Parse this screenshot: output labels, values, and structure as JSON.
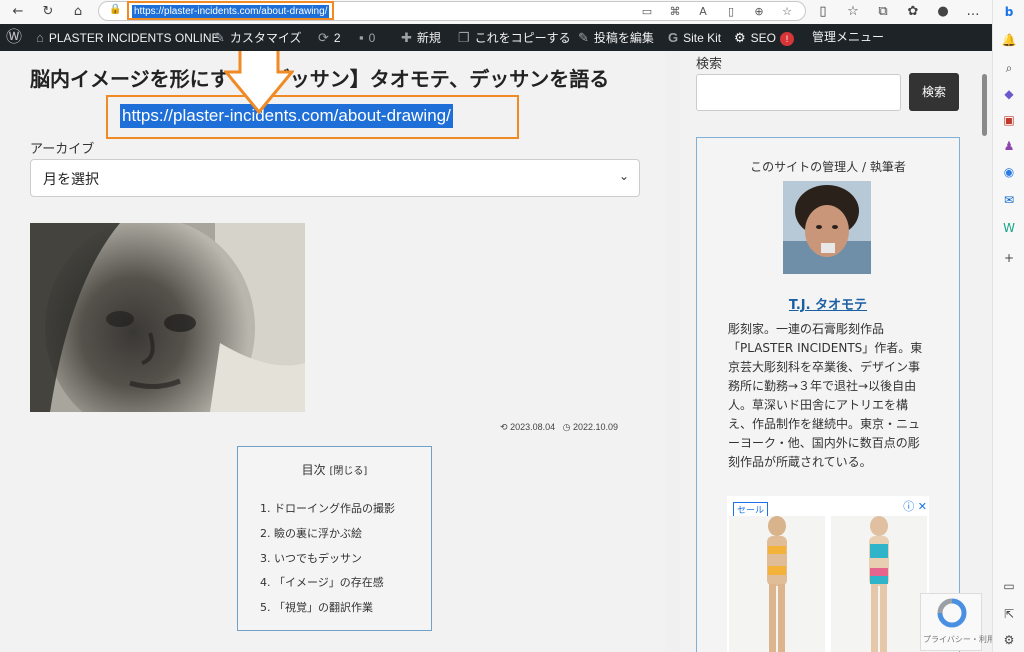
{
  "browser": {
    "url": "https://plaster-incidents.com/about-drawing/",
    "nav_icons": [
      "back-arrow-icon",
      "refresh-icon",
      "home-icon"
    ],
    "right_icons": [
      "app-available-icon",
      "apps-icon",
      "read-aloud-icon",
      "immersive-reader-icon",
      "zoom-icon",
      "favorite-star-icon",
      "split-screen-icon",
      "favorites-icon",
      "collections-icon",
      "extensions-icon",
      "profile-icon",
      "more-icon"
    ],
    "sidebar_icons": [
      "bing-chat-icon",
      "bell-icon",
      "search-icon",
      "tag-icon",
      "briefcase-icon",
      "games-icon",
      "office-icon",
      "outlook-icon",
      "shopping-icon",
      "add-icon",
      "hide-sidebar-icon",
      "open-external-icon",
      "settings-icon"
    ]
  },
  "adminbar": {
    "site_name": "PLASTER INCIDENTS ONLINE",
    "customize": "カスタマイズ",
    "updates_count": "2",
    "comments_count": "0",
    "new": "新規",
    "copy": "これをコピーする",
    "edit_post": "投稿を編集",
    "site_kit": "Site Kit",
    "seo": "SEO",
    "seo_badge": "!",
    "admin_menu": "管理メニュー"
  },
  "post": {
    "title": "脳内イメージを形にする【デッサン】タオモテ、デッサンを語る",
    "highlighted_link": "https://plaster-incidents.com/about-drawing/",
    "archive_label": "アーカイブ",
    "month_select": "月を選択",
    "updated_date": "2023.08.04",
    "published_date": "2022.10.09"
  },
  "toc": {
    "title": "目次",
    "close_label": "[閉じる]",
    "items": [
      "1. ドローイング作品の撮影",
      "2. 瞼の裏に浮かぶ絵",
      "3. いつでもデッサン",
      "4. 「イメージ」の存在感",
      "5. 「視覚」の翻訳作業"
    ]
  },
  "sidebar": {
    "search_label": "検索",
    "search_button": "検索",
    "profile_heading": "このサイトの管理人 / 執筆者",
    "author_name": "T.J. タオモテ",
    "bio": "彫刻家。一連の石膏彫刻作品「PLASTER INCIDENTS」作者。東京芸大彫刻科を卒業後、デザイン事務所に勤務→３年で退社→以後自由人。草深いド田舎にアトリエを構え、作品制作を継続中。東京・ニューヨーク・他、国内外に数百点の彫刻作品が所蔵されている。",
    "ad_badge": "セール",
    "ad_info": "ⓘ ✕"
  },
  "recaptcha": {
    "text": "プライバシー・利用規約"
  },
  "colors": {
    "accent_orange": "#f08a24",
    "selection_blue": "#1e6fd8",
    "adminbar": "#1d2327"
  }
}
